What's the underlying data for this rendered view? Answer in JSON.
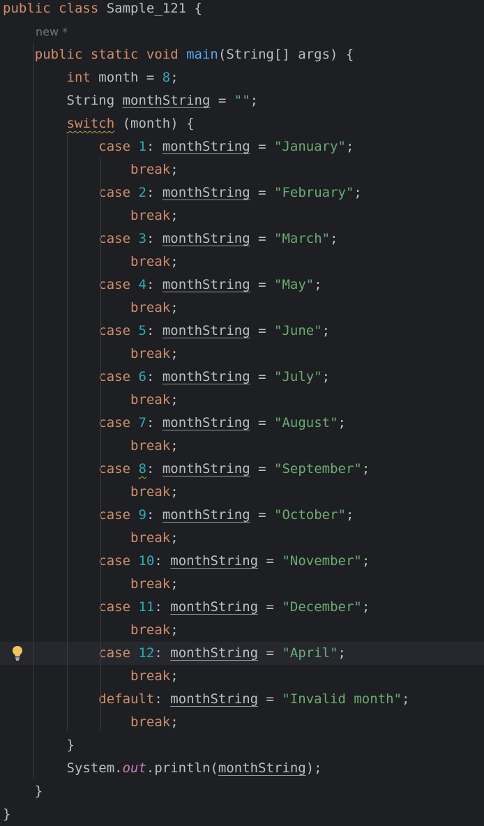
{
  "editor": {
    "hint": "new *",
    "lines": [
      [
        [
          "kw",
          "public class "
        ],
        [
          "",
          "Sample_121 {"
        ]
      ],
      [],
      [
        [
          "",
          "    "
        ],
        [
          "kw",
          "public static void "
        ],
        [
          "fn",
          "main"
        ],
        [
          "",
          "(String[] args) {"
        ]
      ],
      [
        [
          "",
          "        "
        ],
        [
          "kw",
          "int "
        ],
        [
          "",
          "month = "
        ],
        [
          "num",
          "8"
        ],
        [
          "",
          ";"
        ]
      ],
      [
        [
          "",
          "        String "
        ],
        [
          "var",
          "monthString"
        ],
        [
          "",
          " = "
        ],
        [
          "str",
          "\"\""
        ],
        [
          "",
          ";"
        ]
      ],
      [
        [
          "",
          "        "
        ],
        [
          "kw warn",
          "switch"
        ],
        [
          "",
          " (month) {"
        ]
      ],
      [
        [
          "",
          "            "
        ],
        [
          "kw",
          "case "
        ],
        [
          "num",
          "1"
        ],
        [
          "",
          ": "
        ],
        [
          "var",
          "monthString"
        ],
        [
          "",
          " = "
        ],
        [
          "str",
          "\"January\""
        ],
        [
          "",
          ";"
        ]
      ],
      [
        [
          "",
          "                "
        ],
        [
          "kw",
          "break"
        ],
        [
          "",
          ";"
        ]
      ],
      [
        [
          "",
          "            "
        ],
        [
          "kw",
          "case "
        ],
        [
          "num",
          "2"
        ],
        [
          "",
          ": "
        ],
        [
          "var",
          "monthString"
        ],
        [
          "",
          " = "
        ],
        [
          "str",
          "\"February\""
        ],
        [
          "",
          ";"
        ]
      ],
      [
        [
          "",
          "                "
        ],
        [
          "kw",
          "break"
        ],
        [
          "",
          ";"
        ]
      ],
      [
        [
          "",
          "            "
        ],
        [
          "kw",
          "case "
        ],
        [
          "num",
          "3"
        ],
        [
          "",
          ": "
        ],
        [
          "var",
          "monthString"
        ],
        [
          "",
          " = "
        ],
        [
          "str",
          "\"March\""
        ],
        [
          "",
          ";"
        ]
      ],
      [
        [
          "",
          "                "
        ],
        [
          "kw",
          "break"
        ],
        [
          "",
          ";"
        ]
      ],
      [
        [
          "",
          "            "
        ],
        [
          "kw",
          "case "
        ],
        [
          "num",
          "4"
        ],
        [
          "",
          ": "
        ],
        [
          "var",
          "monthString"
        ],
        [
          "",
          " = "
        ],
        [
          "str",
          "\"May\""
        ],
        [
          "",
          ";"
        ]
      ],
      [
        [
          "",
          "                "
        ],
        [
          "kw",
          "break"
        ],
        [
          "",
          ";"
        ]
      ],
      [
        [
          "",
          "            "
        ],
        [
          "kw",
          "case "
        ],
        [
          "num",
          "5"
        ],
        [
          "",
          ": "
        ],
        [
          "var",
          "monthString"
        ],
        [
          "",
          " = "
        ],
        [
          "str",
          "\"June\""
        ],
        [
          "",
          ";"
        ]
      ],
      [
        [
          "",
          "                "
        ],
        [
          "kw",
          "break"
        ],
        [
          "",
          ";"
        ]
      ],
      [
        [
          "",
          "            "
        ],
        [
          "kw",
          "case "
        ],
        [
          "num",
          "6"
        ],
        [
          "",
          ": "
        ],
        [
          "var",
          "monthString"
        ],
        [
          "",
          " = "
        ],
        [
          "str",
          "\"July\""
        ],
        [
          "",
          ";"
        ]
      ],
      [
        [
          "",
          "                "
        ],
        [
          "kw",
          "break"
        ],
        [
          "",
          ";"
        ]
      ],
      [
        [
          "",
          "            "
        ],
        [
          "kw",
          "case "
        ],
        [
          "num",
          "7"
        ],
        [
          "",
          ": "
        ],
        [
          "var",
          "monthString"
        ],
        [
          "",
          " = "
        ],
        [
          "str",
          "\"August\""
        ],
        [
          "",
          ";"
        ]
      ],
      [
        [
          "",
          "                "
        ],
        [
          "kw",
          "break"
        ],
        [
          "",
          ";"
        ]
      ],
      [
        [
          "",
          "            "
        ],
        [
          "kw",
          "case "
        ],
        [
          "num warn",
          "8"
        ],
        [
          "",
          ": "
        ],
        [
          "var",
          "monthString"
        ],
        [
          "",
          " = "
        ],
        [
          "str",
          "\"September\""
        ],
        [
          "",
          ";"
        ]
      ],
      [
        [
          "",
          "                "
        ],
        [
          "kw",
          "break"
        ],
        [
          "",
          ";"
        ]
      ],
      [
        [
          "",
          "            "
        ],
        [
          "kw",
          "case "
        ],
        [
          "num",
          "9"
        ],
        [
          "",
          ": "
        ],
        [
          "var",
          "monthString"
        ],
        [
          "",
          " = "
        ],
        [
          "str",
          "\"October\""
        ],
        [
          "",
          ";"
        ]
      ],
      [
        [
          "",
          "                "
        ],
        [
          "kw",
          "break"
        ],
        [
          "",
          ";"
        ]
      ],
      [
        [
          "",
          "            "
        ],
        [
          "kw",
          "case "
        ],
        [
          "num",
          "10"
        ],
        [
          "",
          ": "
        ],
        [
          "var",
          "monthString"
        ],
        [
          "",
          " = "
        ],
        [
          "str",
          "\"November\""
        ],
        [
          "",
          ";"
        ]
      ],
      [
        [
          "",
          "                "
        ],
        [
          "kw",
          "break"
        ],
        [
          "",
          ";"
        ]
      ],
      [
        [
          "",
          "            "
        ],
        [
          "kw",
          "case "
        ],
        [
          "num",
          "11"
        ],
        [
          "",
          ": "
        ],
        [
          "var",
          "monthString"
        ],
        [
          "",
          " = "
        ],
        [
          "str",
          "\"December\""
        ],
        [
          "",
          ";"
        ]
      ],
      [
        [
          "",
          "                "
        ],
        [
          "kw",
          "break"
        ],
        [
          "",
          ";"
        ]
      ],
      [
        [
          "",
          "            "
        ],
        [
          "kw",
          "case "
        ],
        [
          "num",
          "12"
        ],
        [
          "",
          ": "
        ],
        [
          "var",
          "monthString"
        ],
        [
          "",
          " = "
        ],
        [
          "str",
          "\"April\""
        ],
        [
          "",
          ";"
        ]
      ],
      [
        [
          "",
          "                "
        ],
        [
          "kw",
          "break"
        ],
        [
          "",
          ";"
        ]
      ],
      [
        [
          "",
          "            "
        ],
        [
          "kw",
          "default"
        ],
        [
          "",
          ": "
        ],
        [
          "var",
          "monthString"
        ],
        [
          "",
          " = "
        ],
        [
          "str",
          "\"Invalid month\""
        ],
        [
          "",
          ";"
        ]
      ],
      [
        [
          "",
          "                "
        ],
        [
          "kw",
          "break"
        ],
        [
          "",
          ";"
        ]
      ],
      [
        [
          "",
          "        }"
        ]
      ],
      [
        [
          "",
          "        System."
        ],
        [
          "fld",
          "out"
        ],
        [
          "",
          ".println("
        ],
        [
          "var",
          "monthString"
        ],
        [
          "",
          ");"
        ]
      ],
      [
        [
          "",
          "    }"
        ]
      ],
      [
        [
          "",
          "}"
        ]
      ]
    ],
    "current_line": 28,
    "colors": {
      "background": "#1e1f22",
      "keyword": "#cf8e6d",
      "number": "#2aacb8",
      "string": "#6aab73",
      "method": "#56a8f5",
      "static_field": "#c77dbb",
      "text": "#bcbec4"
    },
    "gutter_icon": "lightbulb-icon"
  }
}
